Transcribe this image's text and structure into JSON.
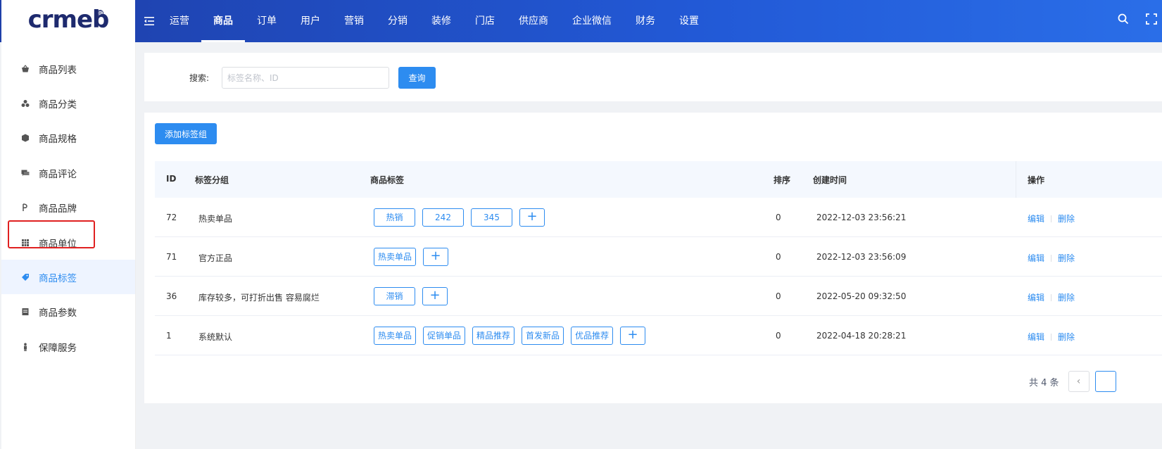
{
  "app": {
    "logo": "crmeb"
  },
  "top_nav": [
    {
      "label": "运营",
      "active": false
    },
    {
      "label": "商品",
      "active": true
    },
    {
      "label": "订单",
      "active": false
    },
    {
      "label": "用户",
      "active": false
    },
    {
      "label": "营销",
      "active": false
    },
    {
      "label": "分销",
      "active": false
    },
    {
      "label": "装修",
      "active": false
    },
    {
      "label": "门店",
      "active": false
    },
    {
      "label": "供应商",
      "active": false
    },
    {
      "label": "企业微信",
      "active": false
    },
    {
      "label": "财务",
      "active": false
    },
    {
      "label": "设置",
      "active": false
    }
  ],
  "sidebar": {
    "items": [
      {
        "label": "商品列表",
        "icon": "basket-icon"
      },
      {
        "label": "商品分类",
        "icon": "cubes-icon"
      },
      {
        "label": "商品规格",
        "icon": "cube-icon"
      },
      {
        "label": "商品评论",
        "icon": "comment-icon"
      },
      {
        "label": "商品品牌",
        "icon": "brand-icon"
      },
      {
        "label": "商品单位",
        "icon": "grid-icon"
      },
      {
        "label": "商品标签",
        "icon": "tag-icon",
        "active": true
      },
      {
        "label": "商品参数",
        "icon": "list-icon"
      },
      {
        "label": "保障服务",
        "icon": "person-icon"
      }
    ]
  },
  "search": {
    "label": "搜索:",
    "placeholder": "标签名称、ID",
    "value": "",
    "button": "查询"
  },
  "toolbar": {
    "add_label": "添加标签组"
  },
  "table": {
    "columns": {
      "id": "ID",
      "group": "标签分组",
      "tags": "商品标签",
      "sort": "排序",
      "created": "创建时间",
      "ops": "操作"
    },
    "rows": [
      {
        "id": "72",
        "group": "热卖单品",
        "tags": [
          "热销",
          "242",
          "345"
        ],
        "sort": "0",
        "created": "2022-12-03 23:56:21"
      },
      {
        "id": "71",
        "group": "官方正品",
        "tags": [
          "热卖单品"
        ],
        "sort": "0",
        "created": "2022-12-03 23:56:09"
      },
      {
        "id": "36",
        "group": "库存较多，可打折出售 容易腐烂",
        "tags": [
          "滞销"
        ],
        "sort": "0",
        "created": "2022-05-20 09:32:50"
      },
      {
        "id": "1",
        "group": "系统默认",
        "tags": [
          "热卖单品",
          "促销单品",
          "精品推荐",
          "首发新品",
          "优品推荐"
        ],
        "sort": "0",
        "created": "2022-04-18 20:28:21"
      }
    ],
    "add_tag_symbol": "+",
    "edit_label": "编辑",
    "delete_label": "删除"
  },
  "pagination": {
    "total": "共 4 条",
    "prev_symbol": "‹"
  },
  "colors": {
    "primary": "#2d8cf0",
    "header_start": "#1e3fa9",
    "header_end": "#2a6ee8",
    "highlight": "#e02020"
  }
}
